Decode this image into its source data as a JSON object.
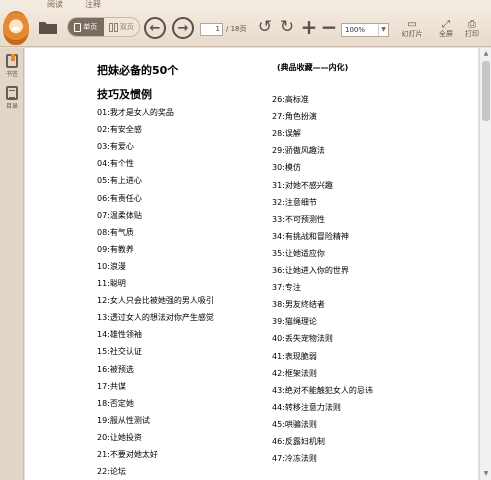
{
  "tabs": [
    {
      "label": "阅读"
    },
    {
      "label": "注释"
    }
  ],
  "toolbar": {
    "view_single": "单页",
    "view_double": "双页",
    "page_current": "1",
    "page_total": "/ 18页",
    "zoom": "100%",
    "slideshow": "幻灯片",
    "fullscreen": "全屏",
    "print": "打印"
  },
  "side": {
    "bookmark_label": "书签",
    "toc_label": "目录"
  },
  "document": {
    "title": "把妹必备的50个",
    "subtitle": "技巧及惯例",
    "tag": "(典品收藏——内化)",
    "left_items": [
      "01:我才是女人的奖品",
      "02:有安全感",
      "03:有爱心",
      "04:有个性",
      "05:有上进心",
      "06:有责任心",
      "07:温柔体贴",
      "08:有气质",
      "09:有教养",
      "10:浪漫",
      "11:聪明",
      "12:女人只会比被她强的男人吸引",
      "13:透过女人的想法对你产生感觉",
      "14:雄性领袖",
      "15:社交认证",
      "16:被预选",
      "17:共谋",
      "18:否定她",
      "19:服从性测试",
      "20:让她投资",
      "21:不要对她太好",
      "22:论坛"
    ],
    "right_items": [
      "26:高标准",
      "27:角色扮演",
      "28:误解",
      "29:骄傲风趣法",
      "30:模仿",
      "31:对她不感兴趣",
      "32:注意细节",
      "33:不可预测性",
      "34:有挑战和冒险精神",
      "35:让她适应你",
      "36:让她进入你的世界",
      "37:专注",
      "38:男友终结者",
      "39:猫绳理论",
      "40:丢失宠物法则",
      "41:表现脆弱",
      "42:框架法则",
      "43:绝对不能触犯女人的忌讳",
      "44:转移注意力法则",
      "45:哄骗法则",
      "46:反露妇机制",
      "47:冷冻法则"
    ]
  }
}
